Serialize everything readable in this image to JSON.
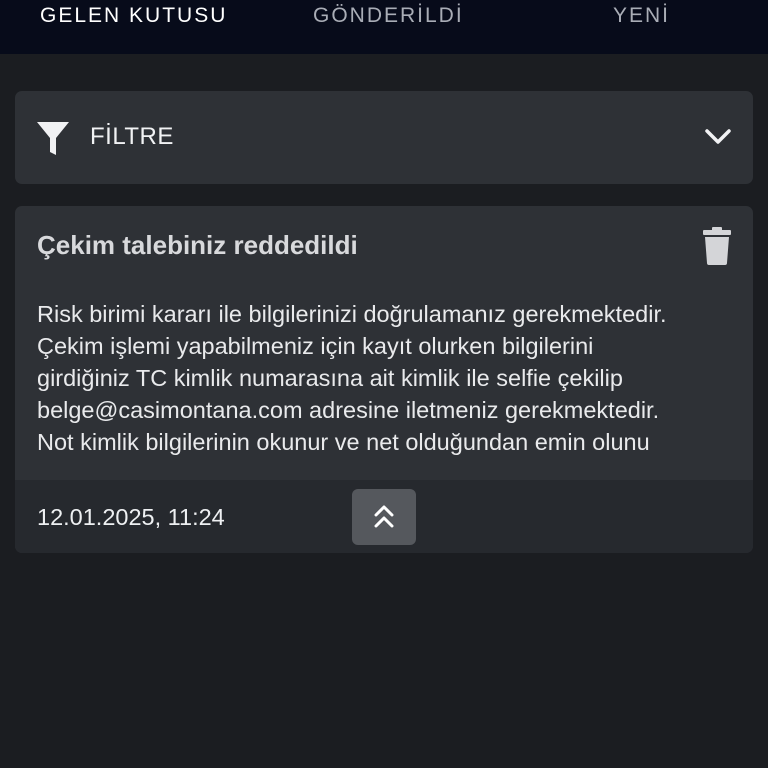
{
  "tabs": [
    {
      "label": "GELEN KUTUSU",
      "active": true
    },
    {
      "label": "GÖNDERİLDİ",
      "active": false
    },
    {
      "label": "YENİ",
      "active": false
    }
  ],
  "filter": {
    "label": "FİLTRE",
    "icon": "filter-icon",
    "toggle_icon": "chevron-down-icon"
  },
  "message": {
    "title": "Çekim talebiniz reddedildi",
    "body_lines": [
      "Risk birimi kararı ile bilgilerinizi doğrulamanız gerekmektedir.",
      "Çekim işlemi yapabilmeniz için kayıt olurken bilgilerini",
      "girdiğiniz TC kimlik numarasına ait kimlik ile selfie çekilip",
      "belge@casimontana.com adresine iletmeniz gerekmektedir.",
      "Not kimlik bilgilerinin okunur ve net olduğundan emin olunu"
    ],
    "date": "12.01.2025, 11:24",
    "delete_icon": "trash-icon",
    "collapse_icon": "double-chevron-up-icon"
  },
  "colors": {
    "background": "#1b1d21",
    "topbar": "#070b1a",
    "card": "#2e3136",
    "card_footer": "#26292e",
    "collapse_button": "#55585d"
  }
}
